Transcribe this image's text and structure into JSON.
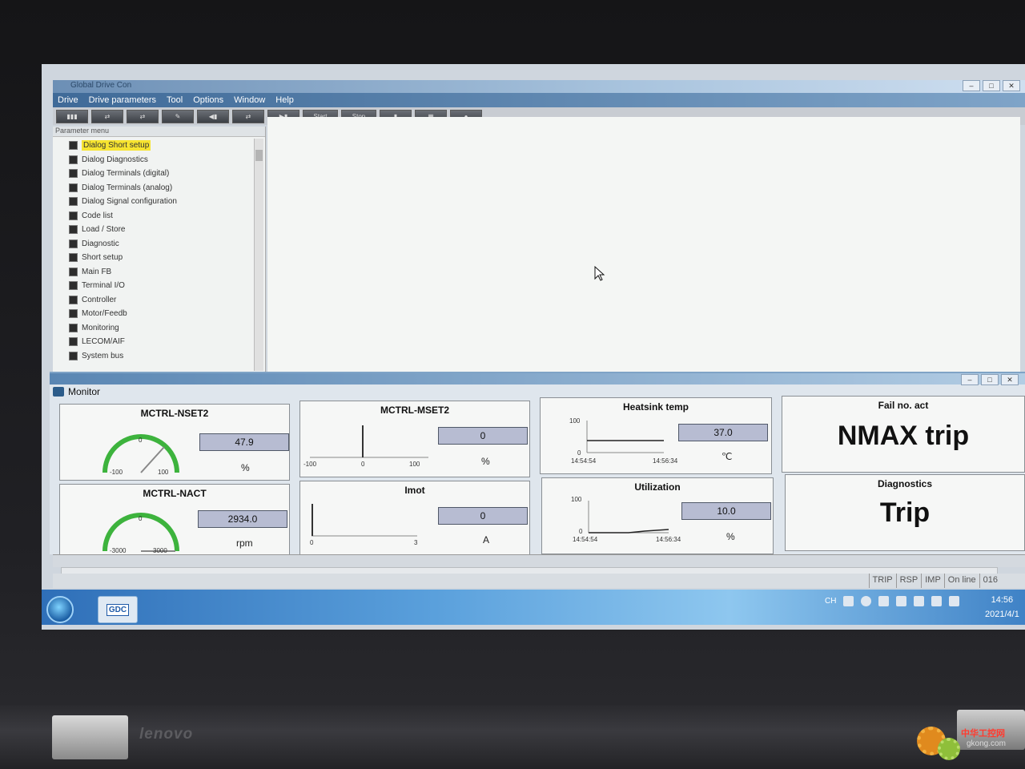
{
  "app": {
    "title": "Global Drive Con"
  },
  "menu": [
    "Drive",
    "Drive parameters",
    "Tool",
    "Options",
    "Window",
    "Help"
  ],
  "toolbar": {
    "start_label": "Start",
    "stop_label": "Stop"
  },
  "param_menu": {
    "header": "Parameter menu",
    "items": [
      {
        "label": "Dialog Short setup",
        "selected": true
      },
      {
        "label": "Dialog Diagnostics"
      },
      {
        "label": "Dialog Terminals (digital)"
      },
      {
        "label": "Dialog Terminals (analog)"
      },
      {
        "label": "Dialog Signal configuration"
      },
      {
        "label": "Code list"
      },
      {
        "label": "Load / Store"
      },
      {
        "label": "Diagnostic"
      },
      {
        "label": "Short setup"
      },
      {
        "label": "Main FB"
      },
      {
        "label": "Terminal I/O"
      },
      {
        "label": "Controller"
      },
      {
        "label": "Motor/Feedb"
      },
      {
        "label": "Monitoring"
      },
      {
        "label": "LECOM/AIF"
      },
      {
        "label": "System bus"
      }
    ]
  },
  "monitor": {
    "title": "Monitor",
    "panels": {
      "nset2": {
        "title": "MCTRL-NSET2",
        "value": "47.9",
        "unit": "%",
        "min": "-100",
        "max": "100",
        "zero": "0"
      },
      "nact": {
        "title": "MCTRL-NACT",
        "value": "2934.0",
        "unit": "rpm",
        "min": "-3000",
        "max": "3000",
        "zero": "0"
      },
      "mset2": {
        "title": "MCTRL-MSET2",
        "value": "0",
        "unit": "%",
        "min": "-100",
        "max": "100",
        "zero": "0"
      },
      "imot": {
        "title": "Imot",
        "value": "0",
        "unit": "A",
        "min": "0",
        "max": "3"
      },
      "heatsink": {
        "title": "Heatsink temp",
        "value": "37.0",
        "unit": "℃",
        "ymax": "100",
        "ymin": "0",
        "t0": "14:54:54",
        "t1": "14:56:34"
      },
      "util": {
        "title": "Utilization",
        "value": "10.0",
        "unit": "%",
        "ymax": "100",
        "ymin": "0",
        "t0": "14:54:54",
        "t1": "14:56:34"
      },
      "fail": {
        "title": "Fail no. act",
        "text": "NMAX trip"
      },
      "diag": {
        "title": "Diagnostics",
        "text": "Trip"
      }
    }
  },
  "status": [
    "TRIP",
    "RSP",
    "IMP",
    "On line",
    "016"
  ],
  "taskbar": {
    "app_label": "GDC",
    "lang": "CH",
    "time": "14:56",
    "date": "2021/4/1"
  },
  "device": {
    "brand": "lenovo"
  },
  "watermark": {
    "cn": "中华工控网",
    "url": "gkong.com"
  }
}
